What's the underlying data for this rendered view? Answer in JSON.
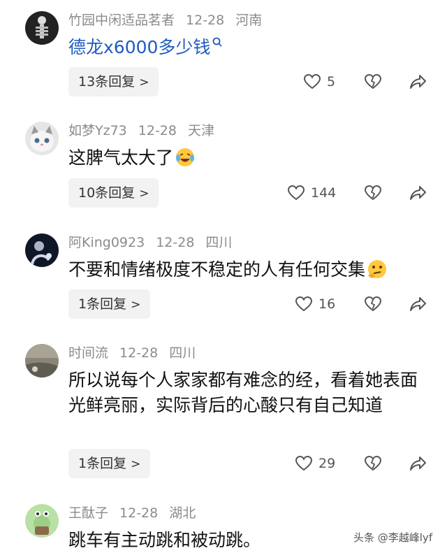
{
  "comments": [
    {
      "username": "竹园中闲适品茗者",
      "date": "12-28",
      "location": "河南",
      "text": "德龙x6000多少钱",
      "replies_label": "13条回复",
      "likes": "5"
    },
    {
      "username": "如梦Yz73",
      "date": "12-28",
      "location": "天津",
      "text": "这脾气太大了",
      "replies_label": "10条回复",
      "likes": "144"
    },
    {
      "username": "阿King0923",
      "date": "12-28",
      "location": "四川",
      "text": "不要和情绪极度不稳定的人有任何交集",
      "replies_label": "1条回复",
      "likes": "16"
    },
    {
      "username": "时间流",
      "date": "12-28",
      "location": "四川",
      "text": "所以说每个人家家都有难念的经，看着她表面光鲜亮丽，实际背后的心酸只有自己知道",
      "replies_label": "1条回复",
      "likes": "29"
    },
    {
      "username": "王酞子",
      "date": "12-28",
      "location": "湖北",
      "text": "跳车有主动跳和被动跳。"
    }
  ],
  "watermark": "头条 @李越峰lyf",
  "icons": {
    "like": "heart-outline-icon",
    "dislike": "broken-heart-icon",
    "share": "share-arrow-icon",
    "search": "search-icon",
    "chevron": "chevron-right-icon"
  },
  "colors": {
    "link": "#1f5bbf",
    "meta": "#8b8b8b"
  }
}
